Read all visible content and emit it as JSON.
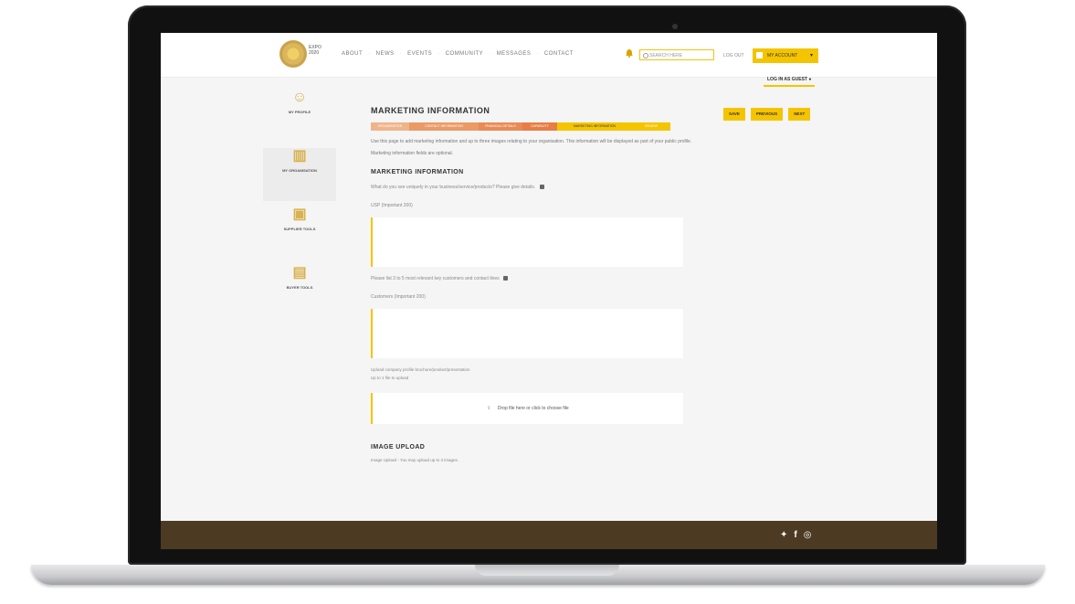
{
  "nav": {
    "logo_text": "EXPO 2020",
    "items": [
      "ABOUT",
      "NEWS",
      "EVENTS",
      "COMMUNITY",
      "MESSAGES",
      "CONTACT"
    ],
    "search_placeholder": "SEARCH HERE",
    "login": "LOG OUT",
    "account_label": "MY ACCOUNT",
    "logout_label": "LOG IN AS GUEST"
  },
  "sidebar": {
    "items": [
      {
        "label": "MY PROFILE",
        "icon": "user-icon"
      },
      {
        "label": "MY ORGANISATION",
        "icon": "building-icon"
      },
      {
        "label": "SUPPLIER TOOLS",
        "icon": "briefcase-icon"
      },
      {
        "label": "BUYER TOOLS",
        "icon": "box-icon"
      }
    ]
  },
  "actions": {
    "save": "SAVE",
    "previous": "PREVIOUS",
    "next": "NEXT"
  },
  "main": {
    "title": "MARKETING INFORMATION",
    "steps": [
      "ORGANISATION",
      "CONTACT INFORMATION",
      "FINANCIAL DETAILS",
      "CAPABILITY",
      "MARKETING INFORMATION",
      "REVIEW"
    ],
    "intro": "Use this page to add marketing information and up to three images relating to your organisation. This information will be displayed as part of your public profile.",
    "note": "Marketing information fields are optional.",
    "section_title": "MARKETING INFORMATION",
    "question1": "What do you see uniquely in your business/service/products? Please give details.",
    "field1_label": "USP (Important 200)",
    "question2": "Please list 3 to 5 most relevant key customers and contact lines",
    "field2_label": "Customers (Important 200)",
    "upload_note1": "Upload company profile brochure/product/presentation",
    "upload_note2": "Up to 1 file to upload",
    "drop_label": "Drop file here or click to choose file",
    "image_title": "IMAGE UPLOAD",
    "image_note": "Image Upload - You may upload up to 3 images."
  },
  "colors": {
    "accent": "#f5c400",
    "footer": "#4c3a23"
  }
}
